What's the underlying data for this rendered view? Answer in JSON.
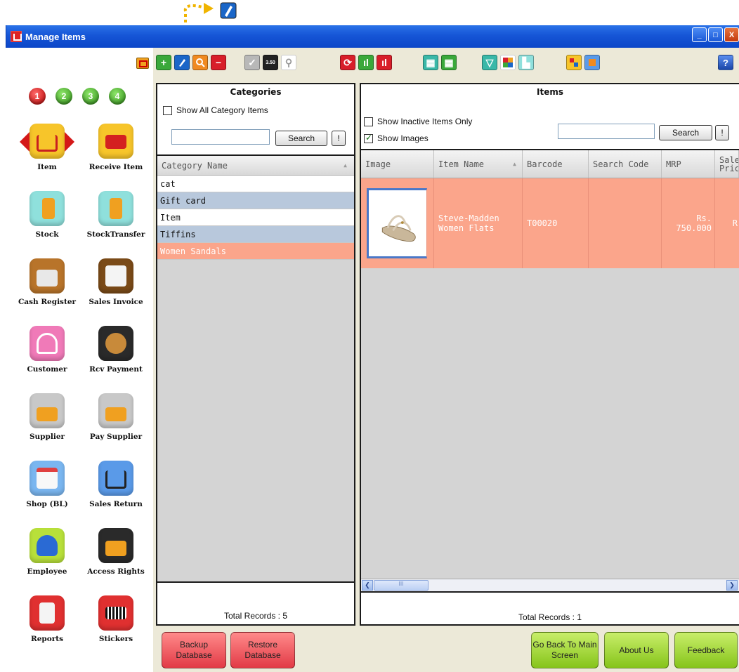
{
  "window": {
    "title": "Manage Items",
    "controls": [
      "_",
      "□",
      "X"
    ]
  },
  "sidebar": {
    "steps": [
      "1",
      "2",
      "3",
      "4"
    ],
    "items": [
      {
        "label": "Item",
        "icon": "shopping-cart-icon",
        "color": "#f7c52a"
      },
      {
        "label": "Receive Item",
        "icon": "truck-icon",
        "color": "#f7c52a"
      },
      {
        "label": "Stock",
        "icon": "hand-truck-icon",
        "color": "#8fe0dc"
      },
      {
        "label": "StockTransfer",
        "icon": "transfer-icon",
        "color": "#8fe0dc"
      },
      {
        "label": "Cash Register",
        "icon": "cash-register-icon",
        "color": "#b8742a"
      },
      {
        "label": "Sales Invoice",
        "icon": "invoice-icon",
        "color": "#7a4a18"
      },
      {
        "label": "Customer",
        "icon": "customer-icon",
        "color": "#f07ab8"
      },
      {
        "label": "Rcv Payment",
        "icon": "payment-icon",
        "color": "#2a2a2a"
      },
      {
        "label": "Supplier",
        "icon": "factory-icon",
        "color": "#c8c8c8"
      },
      {
        "label": "Pay Supplier",
        "icon": "factory-arrow-icon",
        "color": "#c8c8c8"
      },
      {
        "label": "Shop (BL)",
        "icon": "shop-icon",
        "color": "#7ab6f0"
      },
      {
        "label": "Sales Return",
        "icon": "cart-return-icon",
        "color": "#5a9ae8"
      },
      {
        "label": "Employee",
        "icon": "employee-icon",
        "color": "#b8e03a"
      },
      {
        "label": "Access Rights",
        "icon": "lock-key-icon",
        "color": "#2a2a2a"
      },
      {
        "label": "Reports",
        "icon": "reports-icon",
        "color": "#e03030"
      },
      {
        "label": "Stickers",
        "icon": "barcode-icon",
        "color": "#e03030"
      }
    ]
  },
  "categories": {
    "title": "Categories",
    "show_all_label": "Show All Category Items",
    "search_label": "Search",
    "search_value": "",
    "bang_label": "!",
    "column": "Category Name",
    "rows": [
      "cat",
      "Gift card",
      "Item",
      "Tiffins",
      "Women Sandals"
    ],
    "total": "Total Records : 5"
  },
  "items": {
    "title": "Items",
    "show_inactive_label": "Show Inactive Items Only",
    "show_images_label": "Show Images",
    "search_label": "Search",
    "search_value": "",
    "bang_label": "!",
    "columns": [
      "Image",
      "Item Name",
      "Barcode",
      "Search Code",
      "MRP",
      "Sale Price"
    ],
    "rows": [
      {
        "name": "Steve-Madden Women Flats",
        "barcode": "T00020",
        "search_code": "",
        "mrp": "Rs. 750.000",
        "sale_price": "R"
      }
    ],
    "scroll_mark": "III",
    "total": "Total Records : 1"
  },
  "footer": {
    "backup": "Backup Database",
    "restore": "Restore Database",
    "go_back": "Go Back To Main Screen",
    "about": "About Us",
    "feedback": "Feedback"
  },
  "toolbar": {
    "help": "?",
    "amount": "3.50"
  }
}
